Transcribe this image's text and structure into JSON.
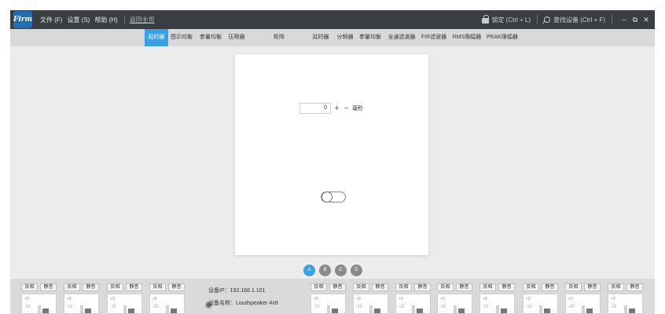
{
  "app": {
    "logo_text": "Firm"
  },
  "menu": {
    "file": "文件 (F)",
    "settings": "设置 (S)",
    "help": "帮助 (H)",
    "home": "返回主页"
  },
  "titlebar_right": {
    "lock": "锁定 (Ctrl + L)",
    "find_device": "查找设备 (Ctrl + F)",
    "minimize": "–",
    "restore": "⧉",
    "close": "✕"
  },
  "tabs": [
    {
      "label": "延时器",
      "active": true
    },
    {
      "label": "图示均衡",
      "active": false
    },
    {
      "label": "参量均衡",
      "active": false
    },
    {
      "label": "压限器",
      "active": false
    },
    {
      "label": "矩阵",
      "active": false
    },
    {
      "label": "延时器",
      "active": false
    },
    {
      "label": "分频器",
      "active": false
    },
    {
      "label": "参量均衡",
      "active": false
    },
    {
      "label": "全通滤波器",
      "active": false
    },
    {
      "label": "FIR滤波器",
      "active": false
    },
    {
      "label": "RMS限幅器",
      "active": false
    },
    {
      "label": "PEAK限幅器",
      "active": false
    }
  ],
  "delay": {
    "value": "0",
    "plus": "+",
    "minus": "−",
    "unit": "毫秒"
  },
  "pagers": [
    "A",
    "B",
    "C",
    "D"
  ],
  "pager_active": "A",
  "channel_buttons": {
    "invert": "反相",
    "mute": "静音"
  },
  "meter_ticks": [
    "+0",
    "-12"
  ],
  "device": {
    "ip_label": "设备IP：192.168.1.101",
    "name_label": "设备名称：Loudspeaker 4x8"
  },
  "colors": {
    "accent": "#3aa0e6",
    "titlebar": "#3a3d42"
  }
}
